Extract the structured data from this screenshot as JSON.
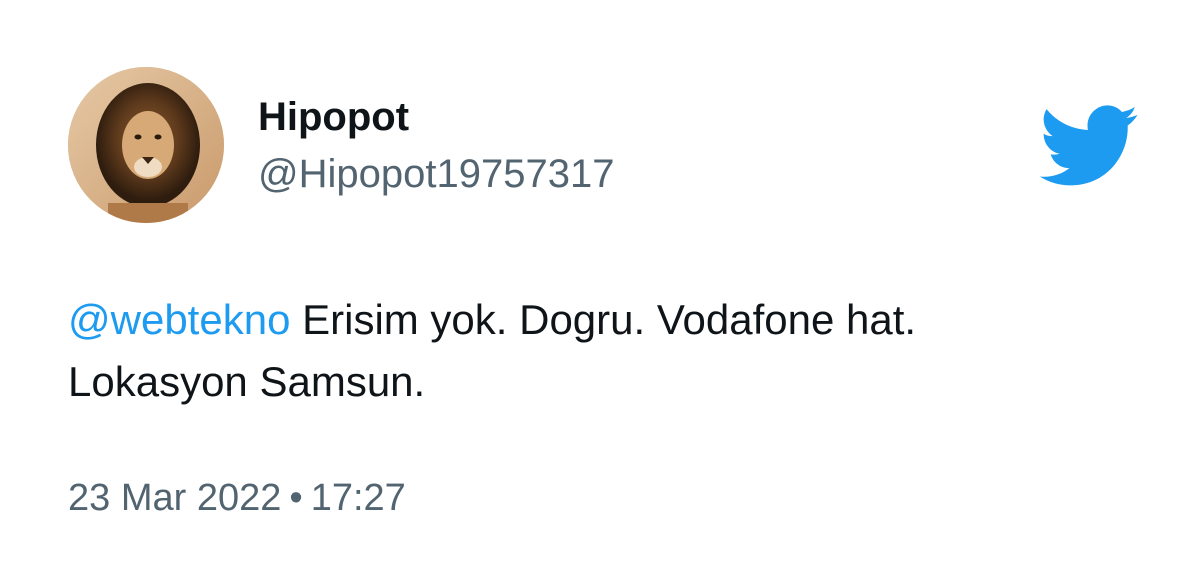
{
  "user": {
    "display_name": "Hipopot",
    "handle": "@Hipopot19757317"
  },
  "tweet": {
    "mention": "@webtekno",
    "line1_rest": " Erisim yok. Dogru. Vodafone hat.",
    "line2": "Lokasyon Samsun."
  },
  "meta": {
    "date": "23 Mar 2022",
    "separator": "•",
    "time": "17:27"
  },
  "icons": {
    "brand": "twitter-bird-icon",
    "avatar": "lion-avatar"
  },
  "colors": {
    "brand_blue": "#1d9bf0",
    "text_primary": "#0f1419",
    "text_secondary": "#536471"
  }
}
